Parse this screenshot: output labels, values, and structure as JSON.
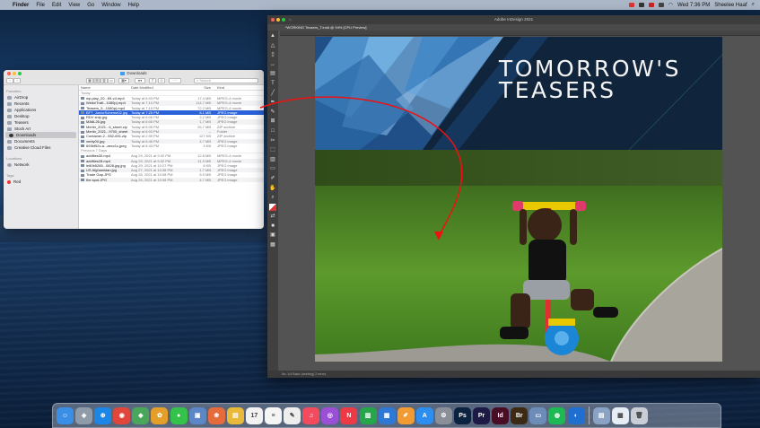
{
  "menubar": {
    "app": "Finder",
    "items": [
      "File",
      "Edit",
      "View",
      "Go",
      "Window",
      "Help"
    ],
    "clock": "Wed 7:36 PM",
    "user": "Sheelee Haaf"
  },
  "finder": {
    "title": "Downloads",
    "search_placeholder": "Search",
    "sidebar": {
      "favorites_label": "Favorites",
      "favorites": [
        "AirDrop",
        "Recents",
        "Applications",
        "Desktop",
        "Teasers",
        "Stock Art",
        "Downloads",
        "Documents",
        "Creative Cloud Files"
      ],
      "active": "Downloads",
      "locations_label": "Locations",
      "locations": [
        "Network"
      ],
      "tags_label": "Tags",
      "tags": [
        "Red"
      ]
    },
    "columns": {
      "name": "Name",
      "date": "Date Modified",
      "size": "Size",
      "kind": "Kind"
    },
    "group_today": "Today",
    "group_prev": "Previous 7 Days",
    "today_files": [
      {
        "name": "wp-play_20...69-v4.mp4",
        "date": "Today at 6:03 PM",
        "size": "17.4 MB",
        "kind": "MPEG-4 movie"
      },
      {
        "name": "Weikr/Trafi...1080p).mp4",
        "date": "Today at 7:10 PM",
        "size": "114.7 MB",
        "kind": "MPEG-4 movie"
      },
      {
        "name": "Teasers_5...1080p).mp4",
        "date": "Today at 7:15 PM",
        "size": "72.2 MB",
        "kind": "MPEG-4 movie"
      },
      {
        "name": "BFT_JuniorScheme02.jpg",
        "date": "Today at 7:25 PM",
        "size": "8.1 MB",
        "kind": "JPEG image",
        "selected": true
      },
      {
        "name": "RDV ship.jpg",
        "date": "Today at 6:06 PM",
        "size": "2.2 MB",
        "kind": "JPEG image"
      },
      {
        "name": "MA6L26.jpg",
        "date": "Today at 6:05 PM",
        "size": "1.7 MB",
        "kind": "JPEG image"
      },
      {
        "name": "Merlin_2021...6_sheet.zip",
        "date": "Today at 6:05 PM",
        "size": "26.7 MB",
        "kind": "ZIP archive"
      },
      {
        "name": "Merlin_2021...9700_sheet",
        "date": "Today at 6:03 PM",
        "size": "--",
        "kind": "Folder"
      },
      {
        "name": "Container-2...552-691.zip",
        "date": "Today at 2:59 PM",
        "size": "127 KB",
        "kind": "ZIP archive"
      },
      {
        "name": "verity00.jpg",
        "date": "Today at 6:45 PM",
        "size": "4.7 MB",
        "kind": "JPEG image"
      },
      {
        "name": "693bf52c-a...aecc1c.jpeg",
        "date": "Today at 6:43 PM",
        "size": "3 KB",
        "kind": "JPEG image"
      }
    ],
    "prev_files": [
      {
        "name": "addfiles30.mp4",
        "date": "Aug 29, 2021 at 9:32 PM",
        "size": "12.8 MB",
        "kind": "MPEG-4 movie"
      },
      {
        "name": "addfiles28.mp4",
        "date": "Aug 29, 2021 at 9:32 PM",
        "size": "11.3 MB",
        "kind": "MPEG-4 movie"
      },
      {
        "name": "le80b5285...0828.jpg.jpg",
        "date": "Aug 29, 2021 at 10:27 PM",
        "size": "8 KB",
        "kind": "JPEG image"
      },
      {
        "name": "US Afghanistan.jpg",
        "date": "Aug 27, 2021 at 10:38 PM",
        "size": "1.7 MB",
        "kind": "JPEG image"
      },
      {
        "name": "Trade Gap.JPG",
        "date": "Aug 26, 2021 at 10:08 PM",
        "size": "5.9 MB",
        "kind": "JPEG image"
      },
      {
        "name": "the spot.JPG",
        "date": "Aug 26, 2021 at 10:08 PM",
        "size": "4.7 MB",
        "kind": "JPEG image"
      }
    ]
  },
  "indesign": {
    "app_title": "Adobe InDesign 2021",
    "doc_tab": "*WORKING Teasers_T.indd @ 94% [CPU Preview]",
    "status": "No. 1/4  Basic (working)  2 errors",
    "headline": "TOMORROW'S\nTEASERS"
  },
  "dock": {
    "apps": [
      {
        "name": "finder",
        "color": "#3a8ee6",
        "glyph": "☺"
      },
      {
        "name": "launchpad",
        "color": "#8f9ba8",
        "glyph": "◈"
      },
      {
        "name": "safari",
        "color": "#1b86e8",
        "glyph": "⊕"
      },
      {
        "name": "chrome",
        "color": "#e0463a",
        "glyph": "◉"
      },
      {
        "name": "maps",
        "color": "#4aa65a",
        "glyph": "◆"
      },
      {
        "name": "photos",
        "color": "#e49f2b",
        "glyph": "✿"
      },
      {
        "name": "messages",
        "color": "#35c24a",
        "glyph": "●"
      },
      {
        "name": "preview",
        "color": "#5b86c7",
        "glyph": "▣"
      },
      {
        "name": "photos-app",
        "color": "#e56a3c",
        "glyph": "❀"
      },
      {
        "name": "notes",
        "color": "#e9b93a",
        "glyph": "▤"
      },
      {
        "name": "calendar",
        "color": "#f2f2f2",
        "glyph": "17"
      },
      {
        "name": "reminders",
        "color": "#f5f5f5",
        "glyph": "≡"
      },
      {
        "name": "textedit",
        "color": "#eeeeee",
        "glyph": "✎"
      },
      {
        "name": "music",
        "color": "#f34a5e",
        "glyph": "♫"
      },
      {
        "name": "podcasts",
        "color": "#9a4fd6",
        "glyph": "◎"
      },
      {
        "name": "news",
        "color": "#ee3a47",
        "glyph": "N"
      },
      {
        "name": "numbers",
        "color": "#27a54a",
        "glyph": "▥"
      },
      {
        "name": "keynote",
        "color": "#2f79d6",
        "glyph": "▦"
      },
      {
        "name": "pages",
        "color": "#f29b33",
        "glyph": "✐"
      },
      {
        "name": "app-store",
        "color": "#2d8ef0",
        "glyph": "A"
      },
      {
        "name": "system-preferences",
        "color": "#8a8f98",
        "glyph": "⚙"
      },
      {
        "name": "photoshop",
        "color": "#0b2240",
        "glyph": "Ps"
      },
      {
        "name": "premiere",
        "color": "#1d1a45",
        "glyph": "Pr"
      },
      {
        "name": "indesign",
        "color": "#4a0d26",
        "glyph": "Id"
      },
      {
        "name": "bridge",
        "color": "#3c2a14",
        "glyph": "Br"
      },
      {
        "name": "screenshot",
        "color": "#6d8db8",
        "glyph": "▭"
      },
      {
        "name": "spotify",
        "color": "#1db954",
        "glyph": "◍"
      },
      {
        "name": "edge",
        "color": "#1f6fd1",
        "glyph": "◐"
      },
      {
        "name": "downloads-stack",
        "color": "#8aa2c4",
        "glyph": "▤"
      },
      {
        "name": "documents-stack",
        "color": "#e7edf5",
        "glyph": "▦"
      },
      {
        "name": "trash",
        "color": "#c9ced6",
        "glyph": "🗑"
      }
    ]
  }
}
